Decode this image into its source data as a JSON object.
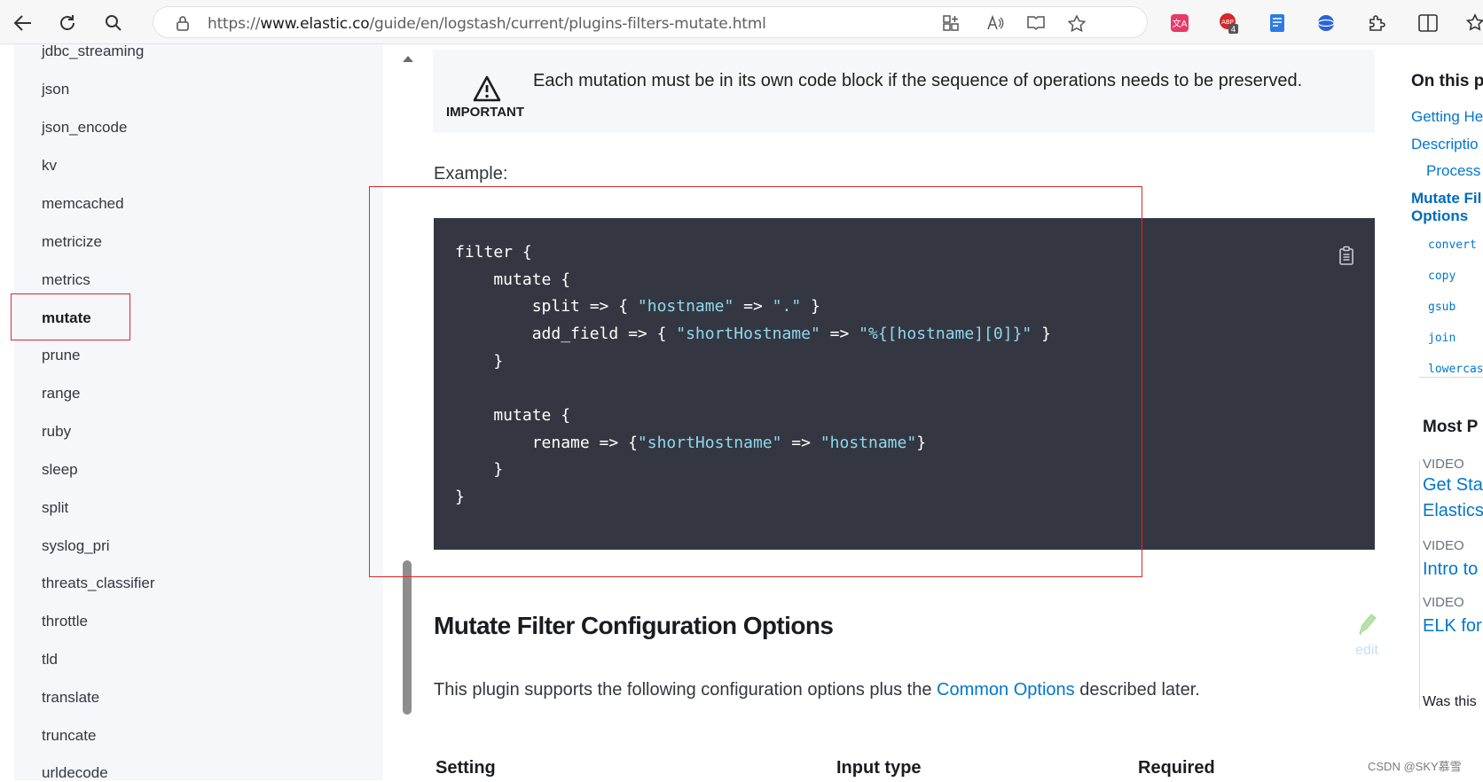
{
  "browser": {
    "url_prefix": "https://",
    "url_host": "www.elastic.co",
    "url_path": "/guide/en/logstash/current/plugins-filters-mutate.html",
    "extension_badge": "4"
  },
  "sidebar": {
    "items": [
      {
        "label": "jdbc_streaming"
      },
      {
        "label": "json"
      },
      {
        "label": "json_encode"
      },
      {
        "label": "kv"
      },
      {
        "label": "memcached"
      },
      {
        "label": "metricize"
      },
      {
        "label": "metrics"
      },
      {
        "label": "mutate",
        "active": true
      },
      {
        "label": "prune"
      },
      {
        "label": "range"
      },
      {
        "label": "ruby"
      },
      {
        "label": "sleep"
      },
      {
        "label": "split"
      },
      {
        "label": "syslog_pri"
      },
      {
        "label": "threats_classifier"
      },
      {
        "label": "throttle"
      },
      {
        "label": "tld"
      },
      {
        "label": "translate"
      },
      {
        "label": "truncate"
      },
      {
        "label": "urldecode"
      }
    ]
  },
  "main": {
    "important_label": "IMPORTANT",
    "important_text": "Each mutation must be in its own code block if the sequence of operations needs to be preserved.",
    "example_label": "Example:",
    "code": {
      "l1": "filter {",
      "l2": "    mutate {",
      "l3a": "        split => { ",
      "l3b": "\"hostname\"",
      "l3c": " => ",
      "l3d": "\".\"",
      "l3e": " }",
      "l4a": "        add_field => { ",
      "l4b": "\"shortHostname\"",
      "l4c": " => ",
      "l4d": "\"%{[hostname][0]}\"",
      "l4e": " }",
      "l5": "    }",
      "l7": "    mutate {",
      "l8a": "        rename => {",
      "l8b": "\"shortHostname\"",
      "l8c": " => ",
      "l8d": "\"hostname\"",
      "l8e": "}",
      "l9": "    }",
      "l10": "}"
    },
    "section_title": "Mutate Filter Configuration Options",
    "edit_label": "edit",
    "desc_before": "This plugin supports the following configuration options plus the ",
    "desc_link": "Common Options",
    "desc_after": " described later.",
    "table_headers": [
      "Setting",
      "Input type",
      "Required"
    ]
  },
  "toc": {
    "title": "On this p",
    "links": [
      "Getting He",
      "Descriptio",
      "Process"
    ],
    "active_line1": "Mutate Fil",
    "active_line2": "Options",
    "code_links": [
      "convert",
      "copy",
      "gsub",
      "join",
      "lowercas"
    ]
  },
  "most_popular": {
    "title": "Most P",
    "videos": [
      {
        "tag": "VIDEO",
        "line1": "Get Sta",
        "line2": "Elastics"
      },
      {
        "tag": "VIDEO",
        "line1": "Intro to",
        "line2": ""
      },
      {
        "tag": "VIDEO",
        "line1": "ELK for",
        "line2": ""
      }
    ],
    "feedback": "Was this"
  },
  "watermark": "CSDN @SKY慕雪",
  "colors": {
    "code_bg": "#343741",
    "code_string": "#8fd8ed",
    "link": "#0077cc",
    "highlight_border": "#e3262b"
  }
}
